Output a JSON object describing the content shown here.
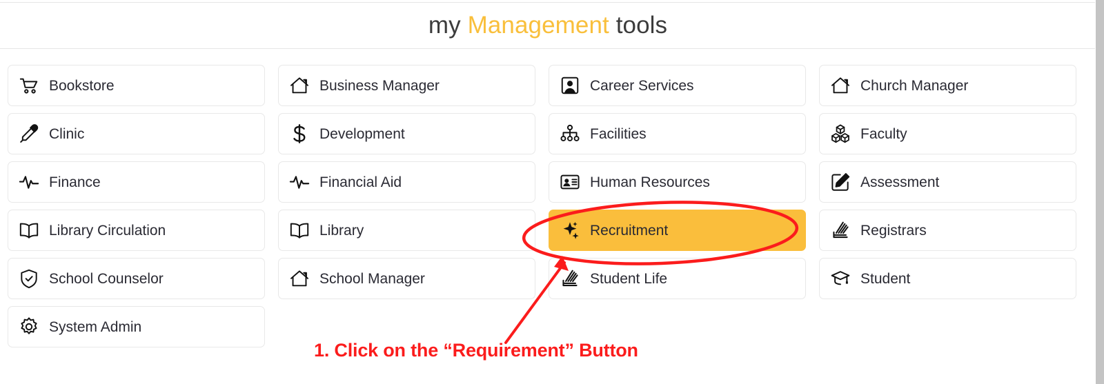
{
  "header": {
    "title_prefix": "my",
    "title_accent": "Management",
    "title_suffix": "tools"
  },
  "colors": {
    "accent_gold": "#f9bf3b",
    "highlight_tile_bg": "#fabe3c",
    "annotation_red": "#fb1c1c",
    "tile_border": "#e8e8e8",
    "text": "#2a2a33"
  },
  "grid": {
    "columns": 4,
    "tiles": [
      {
        "label": "Bookstore",
        "icon": "shopping-cart-icon",
        "highlighted": false
      },
      {
        "label": "Business Manager",
        "icon": "house-icon",
        "highlighted": false
      },
      {
        "label": "Career Services",
        "icon": "user-square-icon",
        "highlighted": false
      },
      {
        "label": "Church Manager",
        "icon": "house-icon",
        "highlighted": false
      },
      {
        "label": "Clinic",
        "icon": "eyedropper-icon",
        "highlighted": false
      },
      {
        "label": "Development",
        "icon": "dollar-sign-icon",
        "highlighted": false
      },
      {
        "label": "Facilities",
        "icon": "org-chart-icon",
        "highlighted": false
      },
      {
        "label": "Faculty",
        "icon": "cubes-icon",
        "highlighted": false
      },
      {
        "label": "Finance",
        "icon": "pulse-icon",
        "highlighted": false
      },
      {
        "label": "Financial Aid",
        "icon": "pulse-icon",
        "highlighted": false
      },
      {
        "label": "Human Resources",
        "icon": "id-card-icon",
        "highlighted": false
      },
      {
        "label": "Assessment",
        "icon": "pencil-square-icon",
        "highlighted": false
      },
      {
        "label": "Library Circulation",
        "icon": "open-book-icon",
        "highlighted": false
      },
      {
        "label": "Library",
        "icon": "open-book-icon",
        "highlighted": false
      },
      {
        "label": "Recruitment",
        "icon": "sparkles-icon",
        "highlighted": true
      },
      {
        "label": "Registrars",
        "icon": "paper-stack-icon",
        "highlighted": false
      },
      {
        "label": "School Counselor",
        "icon": "shield-check-icon",
        "highlighted": false
      },
      {
        "label": "School Manager",
        "icon": "house-icon",
        "highlighted": false
      },
      {
        "label": "Student Life",
        "icon": "paper-stack-icon",
        "highlighted": false
      },
      {
        "label": "Student",
        "icon": "graduation-cap-icon",
        "highlighted": false
      },
      {
        "label": "System Admin",
        "icon": "gear-icon",
        "highlighted": false
      },
      {
        "label": "",
        "icon": "",
        "highlighted": false,
        "empty": true
      },
      {
        "label": "",
        "icon": "",
        "highlighted": false,
        "empty": true
      },
      {
        "label": "",
        "icon": "",
        "highlighted": false,
        "empty": true
      }
    ]
  },
  "annotation": {
    "step_text": "1. Click on the “Requirement” Button",
    "highlight_shape": "red-ellipse-around-recruitment",
    "pointer_shape": "red-arrow-to-recruitment"
  }
}
